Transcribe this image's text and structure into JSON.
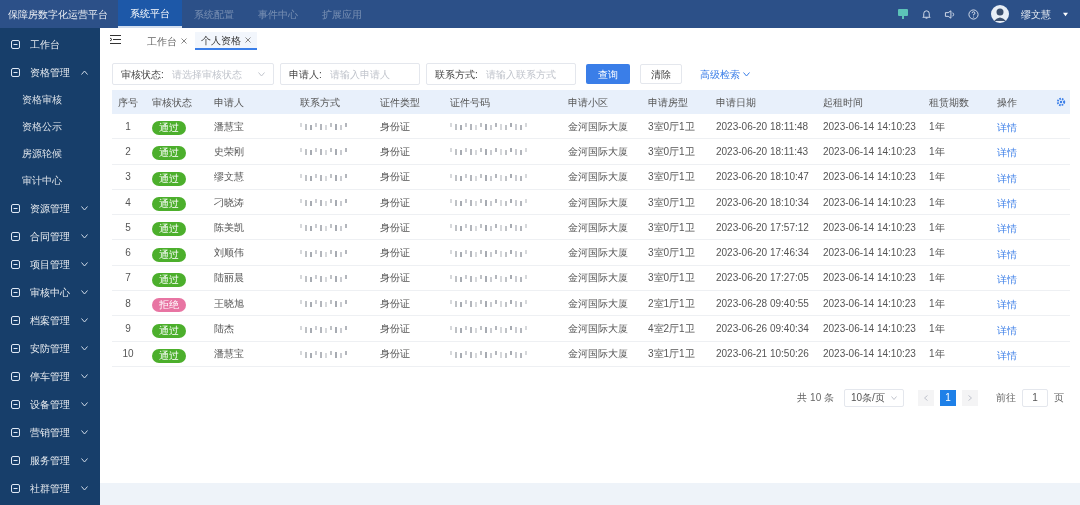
{
  "app_title": "保障房数字化运营平台",
  "top_nav": [
    {
      "label": "系统平台",
      "selected": true
    },
    {
      "label": "系统配置",
      "selected": false
    },
    {
      "label": "事件中心",
      "selected": false
    },
    {
      "label": "扩展应用",
      "selected": false
    }
  ],
  "user": {
    "name": "缪文慧"
  },
  "sidebar": {
    "items": [
      {
        "label": "工作台"
      },
      {
        "label": "资格管理",
        "expanded": true,
        "children": [
          {
            "label": "资格审核"
          },
          {
            "label": "资格公示"
          },
          {
            "label": "房源轮候"
          },
          {
            "label": "审计中心"
          }
        ]
      },
      {
        "label": "资源管理",
        "expanded": false
      },
      {
        "label": "合同管理",
        "expanded": false
      },
      {
        "label": "项目管理",
        "expanded": false
      },
      {
        "label": "审核中心",
        "expanded": false
      },
      {
        "label": "档案管理",
        "expanded": false
      },
      {
        "label": "安防管理",
        "expanded": false
      },
      {
        "label": "停车管理",
        "expanded": false
      },
      {
        "label": "设备管理",
        "expanded": false
      },
      {
        "label": "营销管理",
        "expanded": false
      },
      {
        "label": "服务管理",
        "expanded": false
      },
      {
        "label": "社群管理",
        "expanded": false
      }
    ]
  },
  "tabs": [
    {
      "label": "工作台",
      "selected": false
    },
    {
      "label": "个人资格",
      "selected": true
    }
  ],
  "filters": [
    {
      "label": "审核状态:",
      "placeholder": "请选择审核状态",
      "kind": "select"
    },
    {
      "label": "申请人:",
      "placeholder": "请输入申请人",
      "kind": "text"
    },
    {
      "label": "联系方式:",
      "placeholder": "请输入联系方式",
      "kind": "text"
    }
  ],
  "buttons": {
    "search": "查询",
    "clear": "清除",
    "advanced": "高级检索"
  },
  "table": {
    "columns": [
      "序号",
      "审核状态",
      "申请人",
      "联系方式",
      "证件类型",
      "证件号码",
      "申请小区",
      "申请房型",
      "申请日期",
      "起租时间",
      "租赁期数",
      "操作"
    ],
    "rows": [
      {
        "index": "1",
        "status": {
          "label": "通过",
          "kind": "approved"
        },
        "applicant": "潘慧宝",
        "id_type": "身份证",
        "community": "金河国际大厦",
        "room_type": "3室0厅1卫",
        "apply_date": "2023-06-20 18:11:48",
        "start_date": "2023-06-14 14:10:23",
        "term": "1年",
        "action": "详情"
      },
      {
        "index": "2",
        "status": {
          "label": "通过",
          "kind": "approved"
        },
        "applicant": "史荣刚",
        "id_type": "身份证",
        "community": "金河国际大厦",
        "room_type": "3室0厅1卫",
        "apply_date": "2023-06-20 18:11:43",
        "start_date": "2023-06-14 14:10:23",
        "term": "1年",
        "action": "详情"
      },
      {
        "index": "3",
        "status": {
          "label": "通过",
          "kind": "approved"
        },
        "applicant": "缪文慧",
        "id_type": "身份证",
        "community": "金河国际大厦",
        "room_type": "3室0厅1卫",
        "apply_date": "2023-06-20 18:10:47",
        "start_date": "2023-06-14 14:10:23",
        "term": "1年",
        "action": "详情"
      },
      {
        "index": "4",
        "status": {
          "label": "通过",
          "kind": "approved"
        },
        "applicant": "刁晓涛",
        "id_type": "身份证",
        "community": "金河国际大厦",
        "room_type": "3室0厅1卫",
        "apply_date": "2023-06-20 18:10:34",
        "start_date": "2023-06-14 14:10:23",
        "term": "1年",
        "action": "详情"
      },
      {
        "index": "5",
        "status": {
          "label": "通过",
          "kind": "approved"
        },
        "applicant": "陈美凯",
        "id_type": "身份证",
        "community": "金河国际大厦",
        "room_type": "3室0厅1卫",
        "apply_date": "2023-06-20 17:57:12",
        "start_date": "2023-06-14 14:10:23",
        "term": "1年",
        "action": "详情"
      },
      {
        "index": "6",
        "status": {
          "label": "通过",
          "kind": "approved"
        },
        "applicant": "刘顺伟",
        "id_type": "身份证",
        "community": "金河国际大厦",
        "room_type": "3室0厅1卫",
        "apply_date": "2023-06-20 17:46:34",
        "start_date": "2023-06-14 14:10:23",
        "term": "1年",
        "action": "详情"
      },
      {
        "index": "7",
        "status": {
          "label": "通过",
          "kind": "approved"
        },
        "applicant": "陆丽晨",
        "id_type": "身份证",
        "community": "金河国际大厦",
        "room_type": "3室0厅1卫",
        "apply_date": "2023-06-20 17:27:05",
        "start_date": "2023-06-14 14:10:23",
        "term": "1年",
        "action": "详情"
      },
      {
        "index": "8",
        "status": {
          "label": "拒绝",
          "kind": "rejected"
        },
        "applicant": "王晓旭",
        "id_type": "身份证",
        "community": "金河国际大厦",
        "room_type": "2室1厅1卫",
        "apply_date": "2023-06-28 09:40:55",
        "start_date": "2023-06-14 14:10:23",
        "term": "1年",
        "action": "详情"
      },
      {
        "index": "9",
        "status": {
          "label": "通过",
          "kind": "approved"
        },
        "applicant": "陆杰",
        "id_type": "身份证",
        "community": "金河国际大厦",
        "room_type": "4室2厅1卫",
        "apply_date": "2023-06-26 09:40:34",
        "start_date": "2023-06-14 14:10:23",
        "term": "1年",
        "action": "详情"
      },
      {
        "index": "10",
        "status": {
          "label": "通过",
          "kind": "approved"
        },
        "applicant": "潘慧宝",
        "id_type": "身份证",
        "community": "金河国际大厦",
        "room_type": "3室1厅1卫",
        "apply_date": "2023-06-21 10:50:26",
        "start_date": "2023-06-14 14:10:23",
        "term": "1年",
        "action": "详情"
      }
    ]
  },
  "pagination": {
    "total": "共 10 条",
    "page_size": "10条/页",
    "pages": [
      {
        "label": "1",
        "selected": true
      }
    ],
    "goto_label": "前往",
    "goto_value": "1",
    "goto_suffix": "页"
  }
}
